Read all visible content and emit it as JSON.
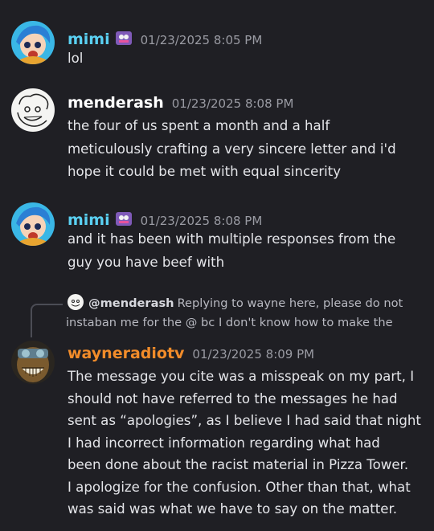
{
  "colors": {
    "background": "#1f1f24",
    "mimi_name": "#5ad0f2",
    "menderash_name": "#ffffff",
    "wayne_name": "#f28c2a",
    "timestamp": "#9a9ba3"
  },
  "messages": [
    {
      "author": "mimi",
      "timestamp": "01/23/2025 8:05 PM",
      "text": "lol",
      "avatar_icon": "anime-girl-avatar-icon",
      "badge_icon": "role-badge-icon"
    },
    {
      "author": "menderash",
      "timestamp": "01/23/2025 8:08 PM",
      "text": "the four of us spent a month and a half\nmeticulously crafting a very sincere letter and i'd\nhope it could be met with equal sincerity",
      "avatar_icon": "sketch-face-avatar-icon"
    },
    {
      "author": "mimi",
      "timestamp": "01/23/2025 8:08 PM",
      "text": "and it has been with multiple responses from the\nguy you have beef with",
      "avatar_icon": "anime-girl-avatar-icon",
      "badge_icon": "role-badge-icon"
    },
    {
      "author": "wayneradiotv",
      "timestamp": "01/23/2025 8:09 PM",
      "text": "The message you cite was a misspeak on my part, I\nshould not have referred to the messages he had\nsent as “apologies”, as I believe I had said that night\nI had incorrect information regarding what had\nbeen done about the racist material in Pizza Tower.\nI apologize for the confusion. Other than that, what\nwas said was what we have to say on the matter.",
      "avatar_icon": "grinning-face-avatar-icon",
      "reply": {
        "author": "@menderash",
        "line1": "Replying to wayne here, please do not",
        "line2": "instaban me for the @ bc I don't know how to make the"
      }
    }
  ]
}
